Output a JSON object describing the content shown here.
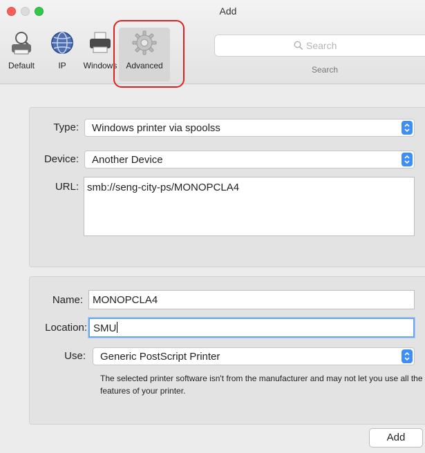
{
  "window": {
    "title": "Add"
  },
  "toolbar": {
    "buttons": [
      {
        "label": "Default",
        "icon": "default-printer-icon"
      },
      {
        "label": "IP",
        "icon": "globe-icon"
      },
      {
        "label": "Windows",
        "icon": "windows-printer-icon"
      },
      {
        "label": "Advanced",
        "icon": "gear-icon",
        "selected": true
      }
    ],
    "search": {
      "placeholder": "Search",
      "label": "Search"
    }
  },
  "connection": {
    "type": {
      "label": "Type:",
      "value": "Windows printer via spoolss"
    },
    "device": {
      "label": "Device:",
      "value": "Another Device"
    },
    "url": {
      "label": "URL:",
      "value": "smb://seng-city-ps/MONOPCLA4"
    }
  },
  "printer": {
    "name": {
      "label": "Name:",
      "value": "MONOPCLA4"
    },
    "location": {
      "label": "Location:",
      "value": "SMU"
    },
    "use": {
      "label": "Use:",
      "value": "Generic PostScript Printer"
    },
    "note": "The selected printer software isn't from the manufacturer and may not let you use all the features of your printer."
  },
  "actions": {
    "add_label": "Add"
  },
  "colors": {
    "accent": "#3d8ef6",
    "highlight": "#e0201e",
    "close": "#fc5f57",
    "zoom": "#34c84a"
  }
}
